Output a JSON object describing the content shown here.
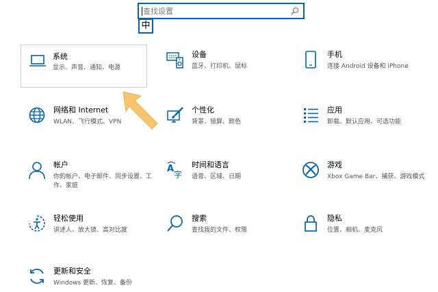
{
  "search": {
    "placeholder": "查找设置",
    "ime_indicator": "中"
  },
  "accent_color": "#0063b1",
  "tiles": [
    {
      "title": "系统",
      "desc": "显示、声音、通知、电源",
      "icon": "laptop-icon",
      "selected": true
    },
    {
      "title": "设备",
      "desc": "蓝牙、打印机、鼠标",
      "icon": "keyboard-speaker-icon"
    },
    {
      "title": "手机",
      "desc": "连接 Android 设备和 iPhone",
      "icon": "phone-icon"
    },
    {
      "title": "网络和 Internet",
      "desc": "WLAN、飞行模式、VPN",
      "icon": "globe-icon"
    },
    {
      "title": "个性化",
      "desc": "背景、锁屏、颜色",
      "icon": "paintbrush-icon"
    },
    {
      "title": "应用",
      "desc": "卸载、默认应用、可选功能",
      "icon": "apps-list-icon"
    },
    {
      "title": "帐户",
      "desc": "你的帐户、电子邮件、同步设置、工作、家庭",
      "icon": "person-icon"
    },
    {
      "title": "时间和语言",
      "desc": "语音、区域、日期",
      "icon": "language-icon"
    },
    {
      "title": "游戏",
      "desc": "Xbox Game Bar、捕获、游戏模式",
      "icon": "xbox-icon"
    },
    {
      "title": "轻松使用",
      "desc": "讲述人、放大镜、高对比度",
      "icon": "ease-of-access-icon"
    },
    {
      "title": "搜索",
      "desc": "查找我的文件、权限",
      "icon": "search-icon"
    },
    {
      "title": "隐私",
      "desc": "位置、相机、麦克风",
      "icon": "lock-icon"
    },
    {
      "title": "更新和安全",
      "desc": "Windows 更新、恢复、备份",
      "icon": "update-icon"
    }
  ]
}
